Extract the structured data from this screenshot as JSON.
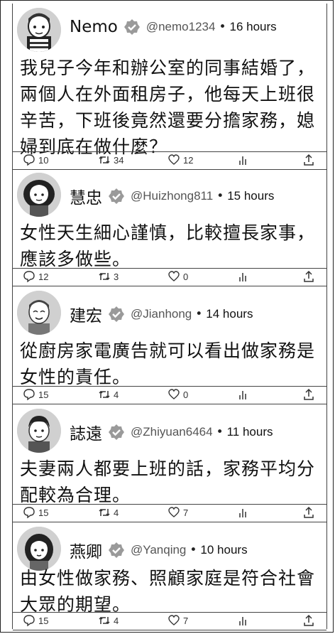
{
  "tweets": [
    {
      "name": "Nemo",
      "handle": "@nemo1234",
      "time": "16 hours",
      "avatar_icon": "cartoon-man-avatar-icon",
      "body": "我兒子今年和辦公室的同事結婚了，兩個人在外面租房子，他每天上班很辛苦，下班後竟然還要分擔家務，媳婦到底在做什麼？",
      "replies": "10",
      "retweets": "34",
      "likes": "12"
    },
    {
      "name": "慧忠",
      "handle": "@Huizhong811",
      "time": "15 hours",
      "avatar_icon": "cartoon-woman-avatar-icon",
      "body": "女性天生細心謹慎，比較擅長家事，應該多做些。",
      "replies": "12",
      "retweets": "3",
      "likes": "0"
    },
    {
      "name": "建宏",
      "handle": "@Jianhong",
      "time": "14 hours",
      "avatar_icon": "cartoon-old-man-avatar-icon",
      "body": "從廚房家電廣告就可以看出做家務是女性的責任。",
      "replies": "15",
      "retweets": "4",
      "likes": "0"
    },
    {
      "name": "誌遠",
      "handle": "@Zhiyuan6464",
      "time": "11 hours",
      "avatar_icon": "cartoon-young-man-avatar-icon",
      "body": "夫妻兩人都要上班的話，家務平均分配較為合理。",
      "replies": "15",
      "retweets": "4",
      "likes": "7"
    },
    {
      "name": "燕卿",
      "handle": "@Yanqing",
      "time": "10 hours",
      "avatar_icon": "cartoon-girl-avatar-icon",
      "body": "由女性做家務、照顧家庭是符合社會大眾的期望。",
      "replies": "15",
      "retweets": "4",
      "likes": "7"
    }
  ],
  "icons": {
    "verified": "verified-badge-icon",
    "reply": "reply-icon",
    "retweet": "retweet-icon",
    "like": "heart-icon",
    "stats": "bar-chart-icon",
    "share": "share-icon"
  },
  "separator": "•"
}
